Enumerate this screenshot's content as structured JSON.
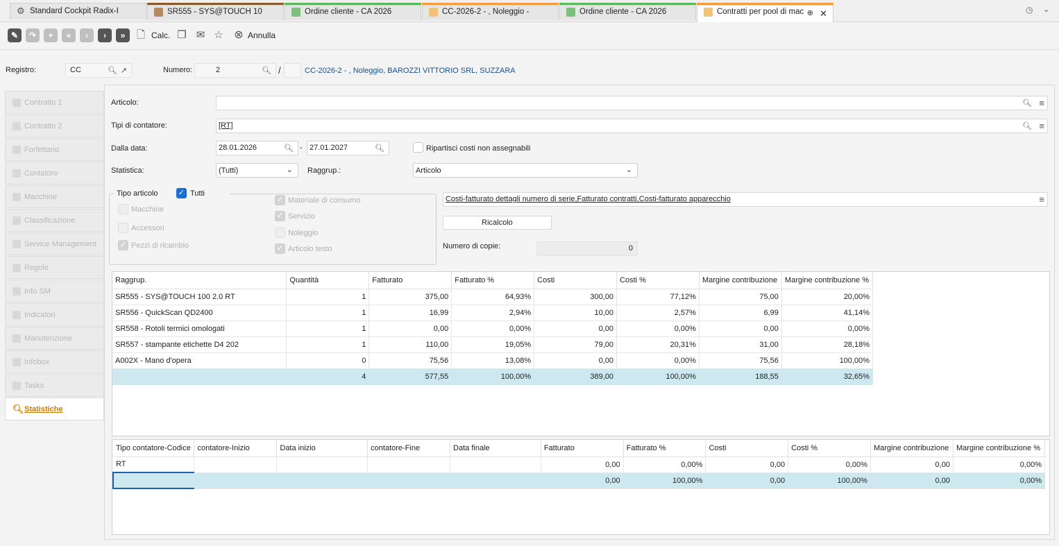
{
  "tabs": [
    {
      "label": "Standard Cockpit Radix-I"
    },
    {
      "label": "SR555 - SYS@TOUCH 10"
    },
    {
      "label": "Ordine cliente - CA 2026"
    },
    {
      "label": "CC-2026-2 - , Noleggio -"
    },
    {
      "label": "Ordine cliente - CA 2026"
    },
    {
      "label": "Contratti per pool di mac"
    }
  ],
  "toolbar": {
    "calc_label": "Calc.",
    "cancel_label": "Annulla"
  },
  "header": {
    "registro_label": "Registro:",
    "registro_value": "CC",
    "numero_label": "Numero:",
    "numero_value": "2",
    "separator": "/",
    "contract_link": "CC-2026-2 - , Noleggio, BAROZZI VITTORIO SRL, SUZZARA"
  },
  "nav": [
    {
      "label": "Contratto 1"
    },
    {
      "label": "Contratto 2"
    },
    {
      "label": "Forfettario"
    },
    {
      "label": "Contatore"
    },
    {
      "label": "Macchine"
    },
    {
      "label": "Classificazione"
    },
    {
      "label": "Service Management"
    },
    {
      "label": "Regole"
    },
    {
      "label": "Info SM"
    },
    {
      "label": "Indicatori"
    },
    {
      "label": "Manutenzione"
    },
    {
      "label": "Infobox"
    },
    {
      "label": "Tasks"
    },
    {
      "label": "Statistiche"
    }
  ],
  "filters": {
    "articolo_label": "Articolo:",
    "articolo_value": "",
    "tipi_label": "Tipi di contatore:",
    "tipi_value": "[RT]",
    "dalla_label": "Dalla data:",
    "date_from": "28.01.2026",
    "date_sep": "-",
    "date_to": "27.01.2027",
    "ripartisci_label": "Ripartisci costi non assegnabili",
    "statistica_label": "Statistica:",
    "statistica_value": "(Tutti)",
    "raggrup_label": "Raggrup.:",
    "raggrup_value": "Articolo"
  },
  "tipo_articolo": {
    "title": "Tipo articolo",
    "tutti": "Tutti",
    "macchine": "Macchine",
    "accessori": "Accessori",
    "pezzi": "Pezzi di ricambio",
    "materiale": "Materiale di consumo",
    "servizio": "Servizio",
    "noleggio": "Noleggio",
    "articolo_testo": "Articolo testo"
  },
  "right_panel": {
    "costs_field": "Costi-fatturato dettagli numero di serie,Fatturato contratti,Costi-fatturato apparecchio",
    "ricalcolo": "Ricalcolo",
    "copie_label": "Numero di copie:",
    "copie_value": "0"
  },
  "table1": {
    "headers": [
      "Raggrup.",
      "Quantità",
      "Fatturato",
      "Fatturato %",
      "Costi",
      "Costi %",
      "Margine contribuzione",
      "Margine contribuzione %"
    ],
    "rows": [
      [
        "SR555 - SYS@TOUCH 100 2.0 RT",
        "1",
        "375,00",
        "64,93%",
        "300,00",
        "77,12%",
        "75,00",
        "20,00%"
      ],
      [
        "SR556 - QuickScan QD2400",
        "1",
        "16,99",
        "2,94%",
        "10,00",
        "2,57%",
        "6,99",
        "41,14%"
      ],
      [
        "SR558 - Rotoli termici omologati",
        "1",
        "0,00",
        "0,00%",
        "0,00",
        "0,00%",
        "0,00",
        "0,00%"
      ],
      [
        "SR557 - stampante etichette D4 202",
        "1",
        "110,00",
        "19,05%",
        "79,00",
        "20,31%",
        "31,00",
        "28,18%"
      ],
      [
        "A002X - Mano d'opera",
        "0",
        "75,56",
        "13,08%",
        "0,00",
        "0,00%",
        "75,56",
        "100,00%"
      ]
    ],
    "total": [
      "",
      "4",
      "577,55",
      "100,00%",
      "389,00",
      "100,00%",
      "188,55",
      "32,65%"
    ]
  },
  "table2": {
    "headers": [
      "Tipo contatore-Codice",
      "contatore-Inizio",
      "Data inizio",
      "contatore-Fine",
      "Data finale",
      "Fatturato",
      "Fatturato %",
      "Costi",
      "Costi %",
      "Margine contribuzione",
      "Margine contribuzione %"
    ],
    "rows": [
      [
        "RT",
        "",
        "",
        "",
        "",
        "0,00",
        "0,00%",
        "0,00",
        "0,00%",
        "0,00",
        "0,00%"
      ]
    ],
    "total": [
      "",
      "",
      "",
      "",
      "",
      "0,00",
      "100,00%",
      "0,00",
      "100,00%",
      "0,00",
      "0,00%"
    ]
  }
}
